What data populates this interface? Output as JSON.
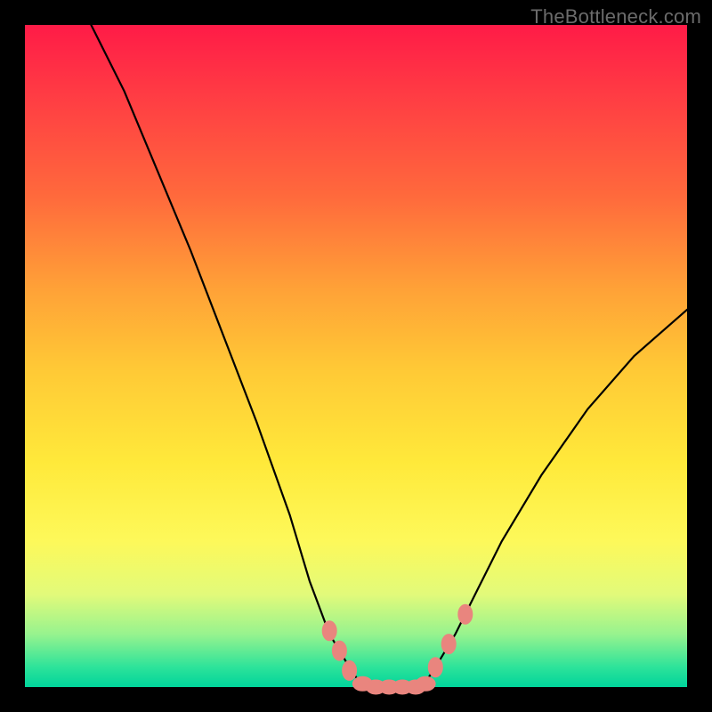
{
  "watermark": "TheBottleneck.com",
  "colors": {
    "frame": "#000000",
    "gradient_top": "#ff1b47",
    "gradient_bottom": "#00d49b",
    "curve": "#000000",
    "marker": "#e9857e"
  },
  "chart_data": {
    "type": "line",
    "title": "",
    "xlabel": "",
    "ylabel": "",
    "xlim": [
      0,
      100
    ],
    "ylim": [
      0,
      100
    ],
    "left_curve": {
      "x": [
        10,
        15,
        20,
        25,
        30,
        35,
        40,
        43,
        46,
        49,
        51
      ],
      "y": [
        100,
        90,
        78,
        66,
        53,
        40,
        26,
        16,
        8,
        3,
        0
      ]
    },
    "right_curve": {
      "x": [
        60,
        62,
        65,
        68,
        72,
        78,
        85,
        92,
        100
      ],
      "y": [
        0,
        3,
        8,
        14,
        22,
        32,
        42,
        50,
        57
      ]
    },
    "flat_segment": {
      "x": [
        51,
        60
      ],
      "y": [
        0,
        0
      ]
    },
    "markers_left": [
      {
        "x": 46.0,
        "y": 8.5
      },
      {
        "x": 47.5,
        "y": 5.5
      },
      {
        "x": 49.0,
        "y": 2.5
      }
    ],
    "markers_right": [
      {
        "x": 62.0,
        "y": 3.0
      },
      {
        "x": 64.0,
        "y": 6.5
      },
      {
        "x": 66.5,
        "y": 11.0
      }
    ],
    "markers_bottom": [
      {
        "x": 51.0,
        "y": 0.5
      },
      {
        "x": 53.0,
        "y": 0.0
      },
      {
        "x": 55.0,
        "y": 0.0
      },
      {
        "x": 57.0,
        "y": 0.0
      },
      {
        "x": 59.0,
        "y": 0.0
      },
      {
        "x": 60.5,
        "y": 0.5
      }
    ]
  }
}
